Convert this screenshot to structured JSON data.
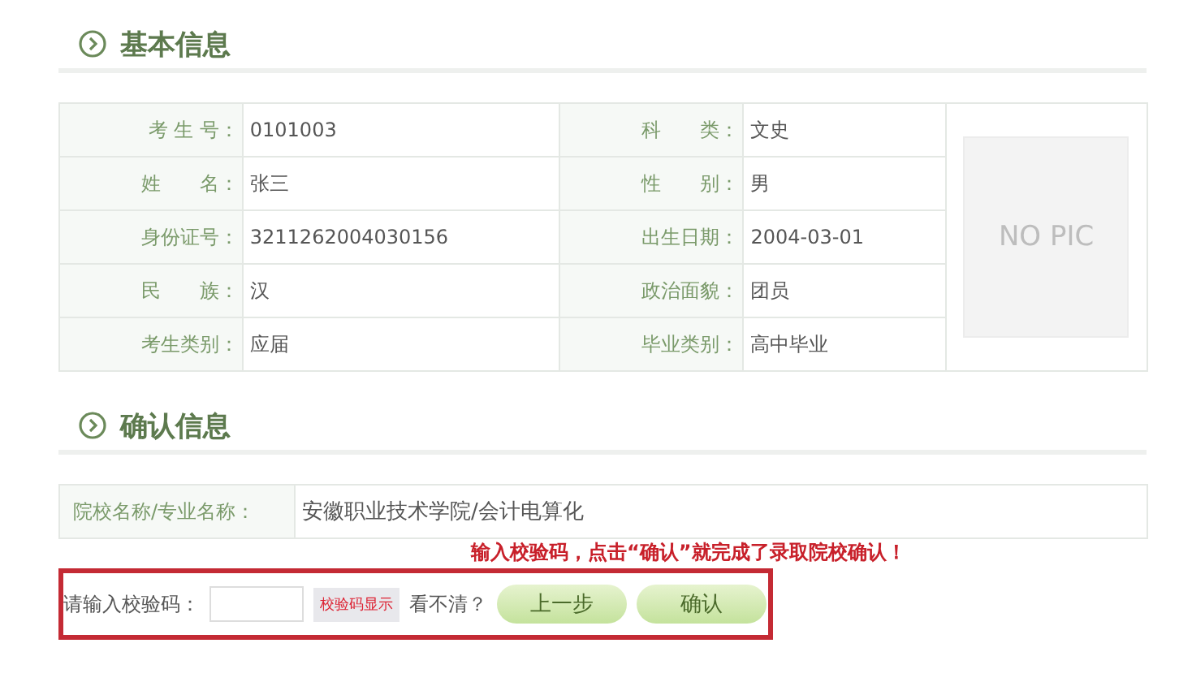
{
  "basic_section": {
    "title": "基本信息"
  },
  "basic_rows": [
    {
      "label_1": "考 生 号：",
      "value_1": "0101003",
      "label_2": "科　　类：",
      "value_2": "文史"
    },
    {
      "label_1": "姓　　名：",
      "value_1": "张三",
      "label_2": "性　　别：",
      "value_2": "男"
    },
    {
      "label_1": "身份证号：",
      "value_1": "3211262004030156",
      "label_2": "出生日期：",
      "value_2": "2004-03-01"
    },
    {
      "label_1": "民　　族：",
      "value_1": "汉",
      "label_2": "政治面貌：",
      "value_2": "团员"
    },
    {
      "label_1": "考生类别：",
      "value_1": "应届",
      "label_2": "毕业类别：",
      "value_2": "高中毕业"
    }
  ],
  "photo": {
    "text": "NO PIC"
  },
  "confirm_section": {
    "title": "确认信息"
  },
  "school_row": {
    "label": "院校名称/专业名称：",
    "value": "安徽职业技术学院/会计电算化"
  },
  "annotation": "输入校验码，点击“确认”就完成了录取院校确认！",
  "captcha": {
    "label": "请输入校验码：",
    "image_text": "校验码显示",
    "hint": "看不清？"
  },
  "buttons": [
    "上一步",
    "确认"
  ]
}
